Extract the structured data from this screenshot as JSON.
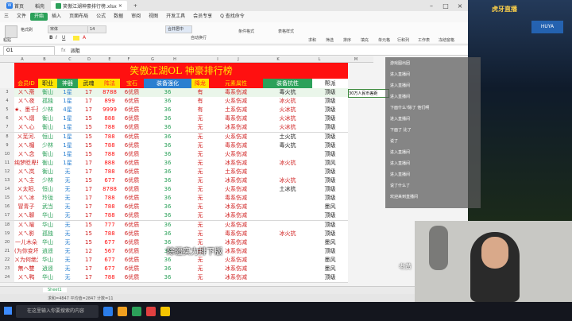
{
  "window": {
    "tabs": [
      {
        "label": "首页"
      },
      {
        "label": "稻壳"
      },
      {
        "label": "笑傲江湖神豪排行榜.xlsx"
      }
    ],
    "menu": [
      "三",
      "文件",
      "开始",
      "插入",
      "页面布局",
      "公式",
      "数据",
      "审阅",
      "视图",
      "开发工具",
      "会员专享",
      "Q 查找命令"
    ],
    "ribbon": {
      "paste": "粘贴",
      "format_painter": "格式刷",
      "font": "宋体",
      "size": "14",
      "wrap": "合并居中",
      "autowrap": "自动换行",
      "cond": "条件格式",
      "style": "表格样式",
      "sum": "求和",
      "filter": "筛选",
      "sort": "排序",
      "fill": "填充",
      "cell": "单元格",
      "rowcol": "行和列",
      "sheet": "工作表",
      "freeze": "冻结窗格"
    },
    "namebox": "O1",
    "formula": "派阻",
    "columns": [
      "A",
      "B",
      "C",
      "D",
      "E",
      "F",
      "G",
      "H",
      "I",
      "J",
      "K",
      "L",
      "M",
      "N",
      "O",
      "P"
    ],
    "sheet_name": "Sheet1",
    "status": "求和=4847  平均值=2847  计数=11"
  },
  "sheet": {
    "title": "笑傲江湖OL  神豪排行榜",
    "headers": [
      "会员ID",
      "职业",
      "神器",
      "武魂",
      "阵法",
      "宝石",
      "装备强化",
      "降龙",
      "元素属性",
      "装备抗性",
      "帮派"
    ],
    "rows": [
      [
        "ㄨㄟ斋",
        "衡山",
        "1星",
        "17",
        "8788",
        "6优质",
        "36",
        "有",
        "毒系伤减",
        "毒火抗",
        "顶级"
      ],
      [
        "ㄨㄟ夜",
        "孤独",
        "1星",
        "17",
        "899",
        "6优质",
        "36",
        "有",
        "火系伤减",
        "冰火抗",
        "顶级"
      ],
      [
        "★、墨千荼",
        "少林",
        "4星",
        "17",
        "9999",
        "6优质",
        "36",
        "有",
        "土系伤减",
        "火冰抗",
        "顶级"
      ],
      [
        "ㄨㄟ熠",
        "衡山",
        "1星",
        "15",
        "888",
        "6优质",
        "36",
        "无",
        "毒系伤减",
        "火冰抗",
        "顶级"
      ],
      [
        "ㄨㄟ心",
        "衡山",
        "1星",
        "15",
        "788",
        "6优质",
        "36",
        "无",
        "冰系伤减",
        "火冰抗",
        "顶级"
      ],
      [
        "ㄨ芜河.",
        "恒山",
        "1星",
        "15",
        "788",
        "6优质",
        "36",
        "无",
        "火系伤减",
        "土火抗",
        "顶级"
      ],
      [
        "ㄨㄟ楣",
        "少林",
        "1星",
        "15",
        "788",
        "6优质",
        "36",
        "无",
        "毒系伤减",
        "毒火抗",
        "顶级"
      ],
      [
        "ㄨㄟ念",
        "衡山",
        "1星",
        "15",
        "788",
        "6优质",
        "36",
        "无",
        "火系伤减",
        "",
        "顶级"
      ],
      [
        "纯梦眨卑轩",
        "衡山",
        "1星",
        "17",
        "888",
        "6优质",
        "36",
        "无",
        "冰系伤减",
        "冰火抗",
        "顶风"
      ],
      [
        "ㄨㄟ岚",
        "衡山",
        "无",
        "17",
        "788",
        "6优质",
        "36",
        "无",
        "土系伤减",
        "",
        "顶级"
      ],
      [
        "ㄨㄟ主",
        "少林",
        "无",
        "15",
        "677",
        "6优质",
        "36",
        "无",
        "冰系伤减",
        "冰火抗",
        "顶级"
      ],
      [
        "ㄨ太阳.",
        "恒山",
        "无",
        "17",
        "8788",
        "6优质",
        "36",
        "无",
        "火系伤减",
        "土冰抗",
        "顶级"
      ],
      [
        "ㄨㄟ冰",
        "玲珑",
        "无",
        "17",
        "788",
        "6优质",
        "36",
        "无",
        "毒系伤减",
        "",
        "顶级"
      ],
      [
        "冒青子",
        "武当",
        "无",
        "17",
        "788",
        "6优质",
        "36",
        "无",
        "冰系伤减",
        "",
        "墨风"
      ],
      [
        "ㄨㄟ聊",
        "华山",
        "无",
        "17",
        "788",
        "6优质",
        "36",
        "无",
        "冰系伤减",
        "",
        "顶级"
      ],
      [
        "ㄨㄟ喻",
        "华山",
        "无",
        "15",
        "777",
        "6优质",
        "36",
        "无",
        "火系伤减",
        "",
        "顶级"
      ],
      [
        "ㄨㄟ影",
        "孤独",
        "无",
        "15",
        "788",
        "6优质",
        "36",
        "无",
        "毒系伤减",
        "冰火抗",
        "顶级"
      ],
      [
        "一ㄦ木朵",
        "华山",
        "无",
        "15",
        "677",
        "6优质",
        "36",
        "无",
        "冰系伤减",
        "",
        "墨风"
      ],
      [
        "(为你变坏)",
        "逍遥",
        "无",
        "12",
        "567",
        "6优质",
        "36",
        "无",
        "冰系伤减",
        "",
        "顶级"
      ],
      [
        "ㄨ为何绝为",
        "华山",
        "无",
        "17",
        "677",
        "6优质",
        "36",
        "无",
        "火系伤减",
        "",
        "墨风"
      ],
      [
        "無ヘ雙",
        "逍遥",
        "无",
        "17",
        "677",
        "6优质",
        "36",
        "无",
        "冰系伤减",
        "",
        "墨风"
      ],
      [
        "ㄨㄟ鸭",
        "华山",
        "无",
        "17",
        "788",
        "6优质",
        "36",
        "无",
        "冰系伤减",
        "",
        "顶级"
      ]
    ],
    "note_cell": "30万人民币差距"
  },
  "overlay": {
    "subtitle_top": "有钱",
    "subtitle_bottom": "除疆实力排下版",
    "subtitle_name": "老黄"
  },
  "chat": [
    "游戏图出团",
    "进入直播间",
    "进入直播间",
    "进入直播间",
    "下面什么?除了 他们啊",
    "进入直播间",
    "下面了 比了",
    "说了",
    "进入直播间",
    "进入直播间",
    "进入直播间",
    "说了什么了",
    "欢迎来到直播间"
  ],
  "game": {
    "top_text": "虎牙直播",
    "watermark": "HUYA"
  },
  "taskbar": {
    "search": "在这里输入你要搜索的内容"
  },
  "colors": {
    "title_bg": "#ff1010",
    "title_fg": "#ffe400",
    "accent": "#2ca15a"
  }
}
